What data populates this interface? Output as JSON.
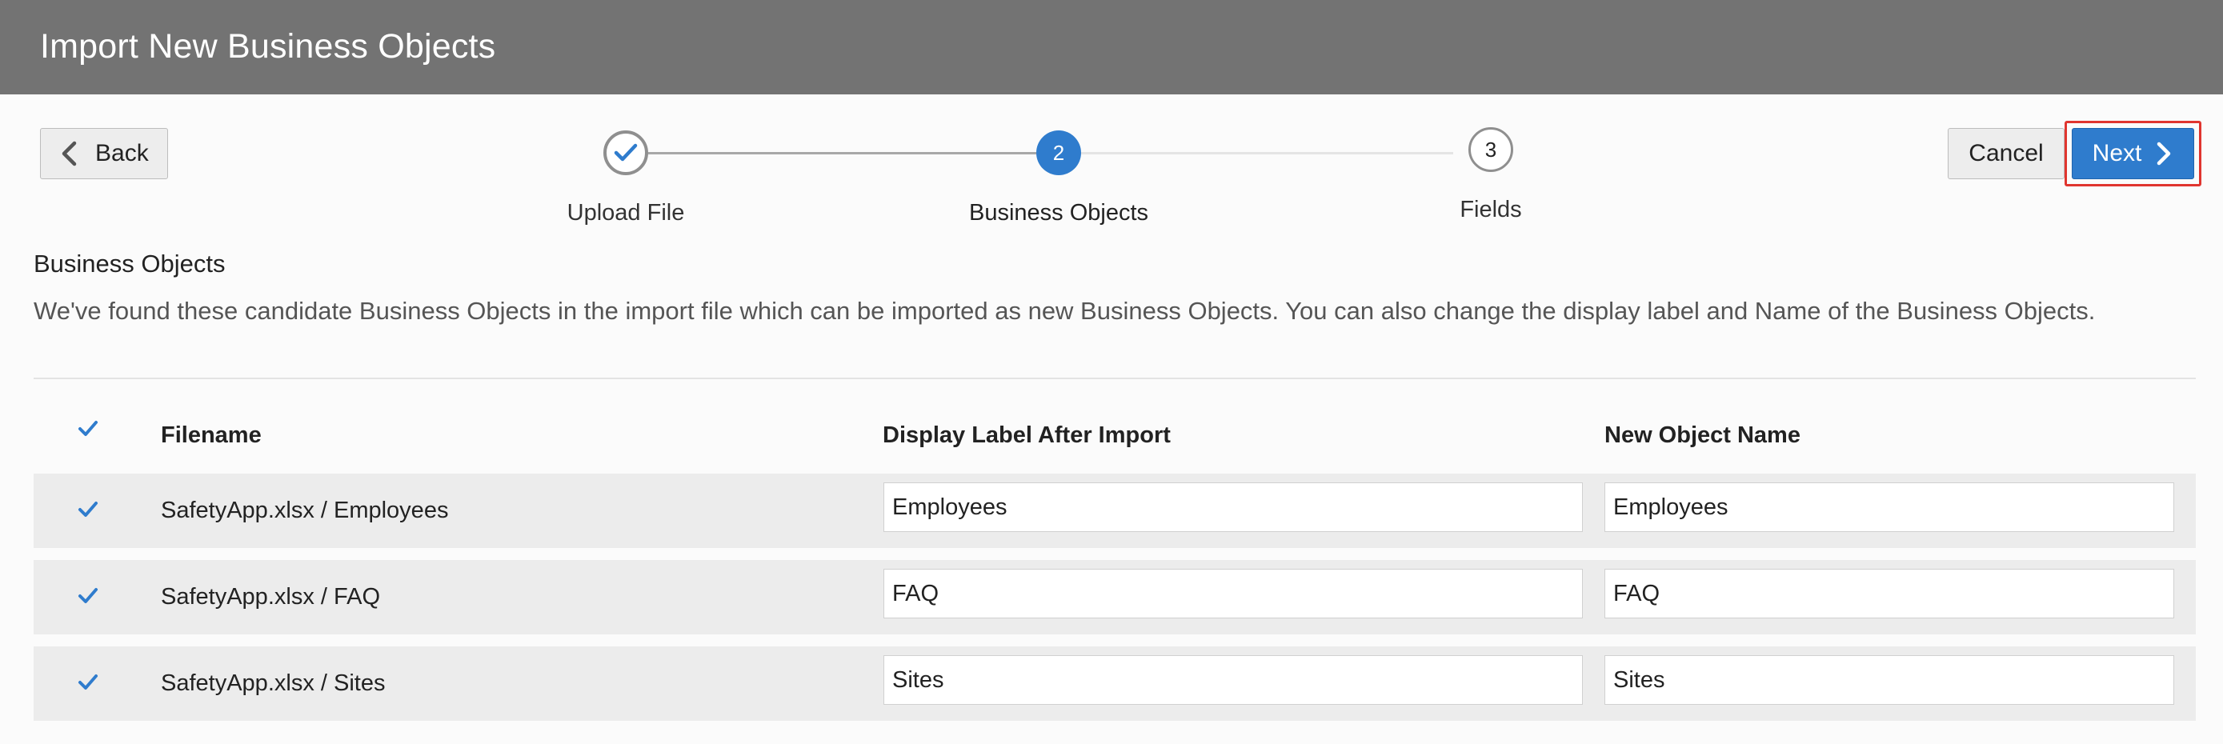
{
  "dialog": {
    "title": "Import New Business Objects"
  },
  "toolbar": {
    "back_label": "Back",
    "cancel_label": "Cancel",
    "next_label": "Next"
  },
  "stepper": {
    "steps": [
      {
        "label": "Upload File",
        "state": "completed",
        "number": "1"
      },
      {
        "label": "Business Objects",
        "state": "current",
        "number": "2"
      },
      {
        "label": "Fields",
        "state": "upcoming",
        "number": "3"
      }
    ]
  },
  "section": {
    "title": "Business Objects",
    "description": "We've found these candidate Business Objects in the import file which can be imported as new Business Objects. You can also change the display label and Name of the Business Objects."
  },
  "table": {
    "columns": [
      "Filename",
      "Display Label After Import",
      "New Object Name"
    ],
    "select_all_checked": true,
    "rows": [
      {
        "checked": true,
        "filename": "SafetyApp.xlsx / Employees",
        "display_label": "Employees",
        "object_name": "Employees"
      },
      {
        "checked": true,
        "filename": "SafetyApp.xlsx / FAQ",
        "display_label": "FAQ",
        "object_name": "FAQ"
      },
      {
        "checked": true,
        "filename": "SafetyApp.xlsx / Sites",
        "display_label": "Sites",
        "object_name": "Sites"
      }
    ]
  },
  "colors": {
    "titlebar": "#737373",
    "accent": "#2f7ccd",
    "highlight_border": "#e0352f",
    "row_bg": "#ececec"
  },
  "icons": {
    "back": "chevron-left-icon",
    "next": "chevron-right-icon",
    "step_done": "check-icon",
    "checkbox": "checkmark-icon"
  }
}
